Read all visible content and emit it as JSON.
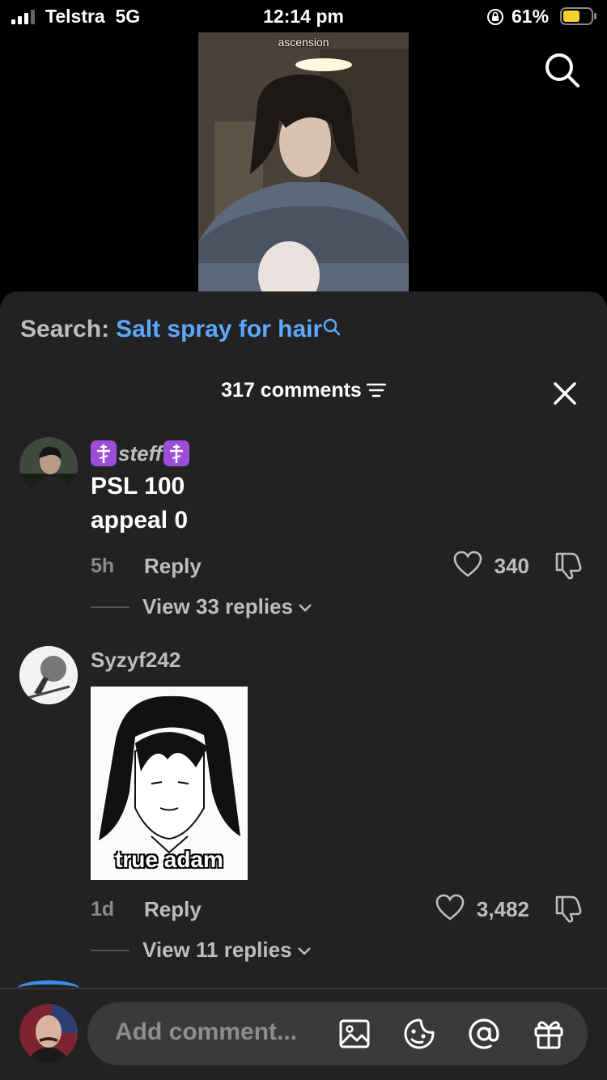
{
  "status_bar": {
    "carrier": "Telstra",
    "network": "5G",
    "time": "12:14 pm",
    "battery_percent": "61%",
    "battery_level": 0.61,
    "battery_color": "#f5d130"
  },
  "video": {
    "caption": "ascension"
  },
  "sheet": {
    "search_prefix": "Search:",
    "search_term": "Salt spray for hair",
    "comment_count": "317 comments",
    "link_color": "#5ea8ff"
  },
  "comments": [
    {
      "username": "steff",
      "text_line1": "PSL 100",
      "text_line2": "appeal 0",
      "age": "5h",
      "reply_label": "Reply",
      "likes": "340",
      "view_replies": "View 33 replies"
    },
    {
      "username": "Syzyf242",
      "image_caption": "true adam",
      "age": "1d",
      "reply_label": "Reply",
      "likes": "3,482",
      "view_replies": "View 11 replies"
    }
  ],
  "composer": {
    "placeholder": "Add comment..."
  }
}
